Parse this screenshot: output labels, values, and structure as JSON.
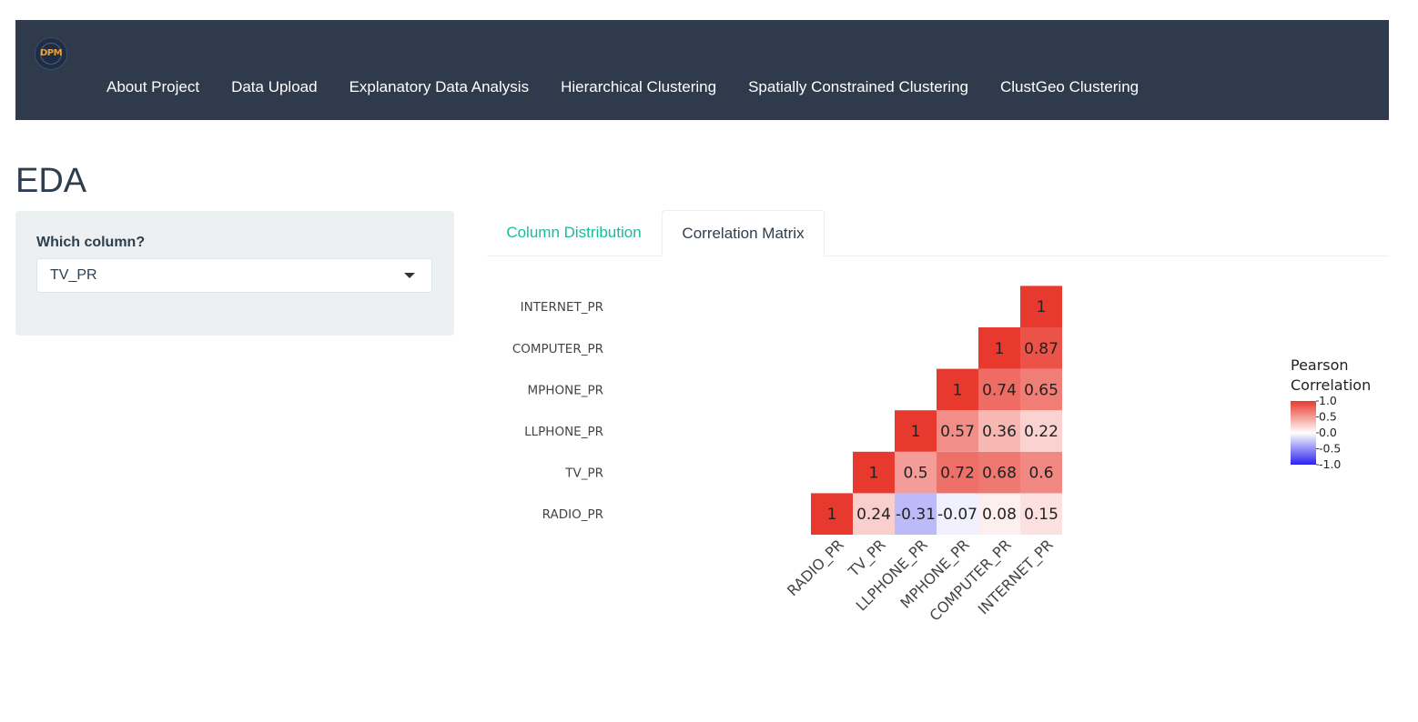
{
  "navbar": {
    "logo_text": "DPM",
    "links": [
      "About Project",
      "Data Upload",
      "Explanatory Data Analysis",
      "Hierarchical Clustering",
      "Spatially Constrained Clustering",
      "ClustGeo Clustering"
    ]
  },
  "page": {
    "title": "EDA"
  },
  "sidebar": {
    "label": "Which column?",
    "selected_value": "TV_PR"
  },
  "tabs": {
    "column_distribution": "Column Distribution",
    "correlation_matrix": "Correlation Matrix",
    "active": "Correlation Matrix"
  },
  "colors": {
    "navbar_bg": "#2f3b4c",
    "accent_green": "#18bc9c",
    "positive": "#e8392e",
    "negative": "#2b22f0",
    "neutral": "#ffffff"
  },
  "chart_data": {
    "type": "heatmap",
    "variables": [
      "RADIO_PR",
      "TV_PR",
      "LLPHONE_PR",
      "MPHONE_PR",
      "COMPUTER_PR",
      "INTERNET_PR"
    ],
    "lower_triangle": [
      [
        1
      ],
      [
        0.24,
        1
      ],
      [
        -0.31,
        0.5,
        1
      ],
      [
        -0.07,
        0.72,
        0.57,
        1
      ],
      [
        0.08,
        0.68,
        0.36,
        0.74,
        1
      ],
      [
        0.15,
        0.6,
        0.22,
        0.65,
        0.87,
        1
      ]
    ],
    "colorbar": {
      "title": [
        "Pearson",
        "Correlation"
      ],
      "range": [
        -1,
        1
      ],
      "ticks": [
        "1.0",
        "0.5",
        "0.0",
        "-0.5",
        "-1.0"
      ]
    }
  }
}
